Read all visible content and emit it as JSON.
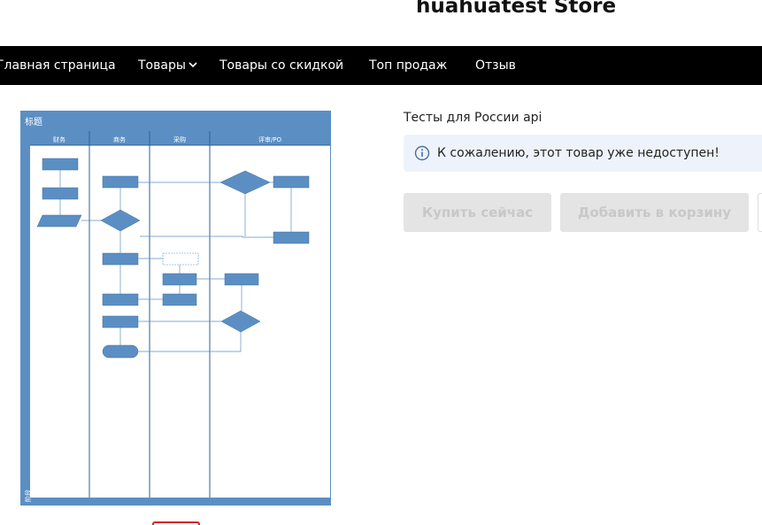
{
  "store": {
    "title": "huahuatest Store"
  },
  "nav": {
    "items": [
      {
        "label": "Главная страница"
      },
      {
        "label": "Товары",
        "has_dropdown": true
      },
      {
        "label": "Товары со скидкой"
      },
      {
        "label": "Топ продаж"
      },
      {
        "label": "Отзыв"
      }
    ]
  },
  "product": {
    "name": "Тесты для России api",
    "notice": "К сожалению, этот товар уже недоступен!",
    "buy_now_label": "Купить сейчас",
    "add_to_cart_label": "Добавить в корзину"
  },
  "flowchart_image": {
    "title": "标题",
    "lanes": [
      "财务",
      "商务",
      "采购",
      "评审/PO"
    ],
    "footer_vertical": "阶段"
  },
  "colors": {
    "nav_bg": "#000000",
    "notice_bg": "#eef3fb",
    "button_disabled_bg": "#e4e4e4",
    "diagram_blue": "#5b8fc4",
    "thumb_border": "#d4202a"
  }
}
